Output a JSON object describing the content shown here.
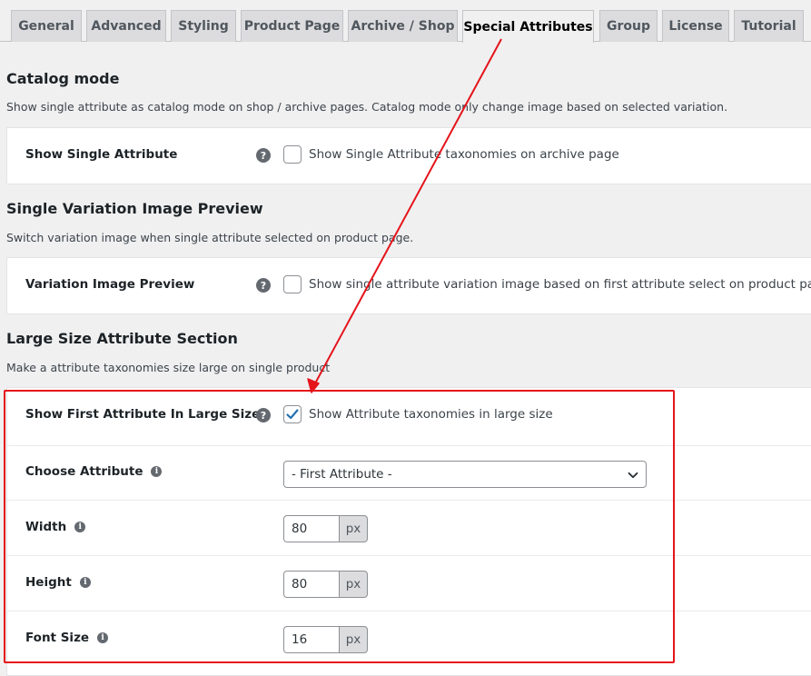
{
  "tabs": [
    {
      "label": "General"
    },
    {
      "label": "Advanced"
    },
    {
      "label": "Styling"
    },
    {
      "label": "Product Page"
    },
    {
      "label": "Archive / Shop"
    },
    {
      "label": "Special Attributes",
      "active": true
    },
    {
      "label": "Group"
    },
    {
      "label": "License"
    },
    {
      "label": "Tutorial"
    }
  ],
  "catalog": {
    "title": "Catalog mode",
    "description": "Show single attribute as catalog mode on shop / archive pages. Catalog mode only change image based on selected variation.",
    "field_label": "Show Single Attribute",
    "checkbox_label": "Show Single Attribute taxonomies on archive page",
    "checked": false
  },
  "preview": {
    "title": "Single Variation Image Preview",
    "description": "Switch variation image when single attribute selected on product page.",
    "field_label": "Variation Image Preview",
    "checkbox_label": "Show single attribute variation image based on first attribute select on product page.",
    "checked": false
  },
  "large": {
    "title": "Large Size Attribute Section",
    "description": "Make a attribute taxonomies size large on single product",
    "show_label": "Show First Attribute In Large Size",
    "show_checkbox_label": "Show Attribute taxonomies in large size",
    "show_checked": true,
    "choose_label": "Choose Attribute",
    "choose_value": "- First Attribute -",
    "width_label": "Width",
    "width_value": "80",
    "width_unit": "px",
    "height_label": "Height",
    "height_value": "80",
    "height_unit": "px",
    "font_label": "Font Size",
    "font_value": "16",
    "font_unit": "px"
  },
  "icons": {
    "help": "?",
    "info": "i"
  },
  "colors": {
    "accent": "#2271b1",
    "annotation": "#e5141b"
  }
}
